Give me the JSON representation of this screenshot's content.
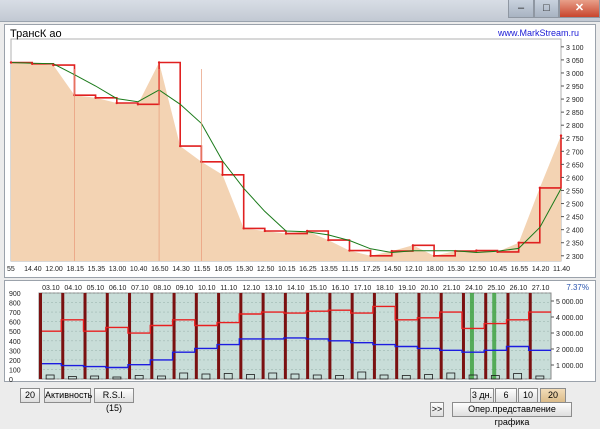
{
  "window": {
    "title": "",
    "buttons": {
      "minimize": "–",
      "maximize": "□",
      "close": "✕"
    }
  },
  "price_chart": {
    "title": "ТрансК ао",
    "site": "www.MarkStream.ru",
    "y_ticks": [
      "3 100",
      "3 050",
      "3 000",
      "2 950",
      "2 900",
      "2 850",
      "2 800",
      "2 750",
      "2 700",
      "2 650",
      "2 600",
      "2 550",
      "2 500",
      "2 450",
      "2 400",
      "2 350",
      "2 300"
    ],
    "x_ticks": [
      "55",
      "14.40",
      "12.00",
      "18.15",
      "15.35",
      "13.00",
      "10.40",
      "16.50",
      "14.30",
      "11.55",
      "18.05",
      "15.30",
      "12.50",
      "10.15",
      "16.25",
      "13.55",
      "11.15",
      "17.25",
      "14.50",
      "12.10",
      "18.00",
      "15.30",
      "12.50",
      "10.45",
      "16.55",
      "14.20",
      "11.40"
    ],
    "colors": {
      "fill": "#f3d3b3",
      "close": "#e02020",
      "ma": "#1a7a1a",
      "accent": "#2222cc"
    }
  },
  "chart_data": [
    {
      "type": "area",
      "title": "ТрансК ао",
      "ylim": [
        2280,
        3130
      ],
      "x": [
        "55",
        "14.40",
        "12.00",
        "18.15",
        "15.35",
        "13.00",
        "10.40",
        "16.50",
        "14.30",
        "11.55",
        "18.05",
        "15.30",
        "12.50",
        "10.15",
        "16.25",
        "13.55",
        "11.15",
        "17.25",
        "14.50",
        "12.10",
        "18.00",
        "15.30",
        "12.50",
        "10.45",
        "16.55",
        "14.20",
        "11.40"
      ],
      "series": [
        {
          "values": [
            3040,
            3035,
            3030,
            2915,
            2905,
            2885,
            2880,
            3040,
            2720,
            2660,
            2610,
            2405,
            2395,
            2385,
            2395,
            2360,
            2320,
            2300,
            2318,
            2340,
            2300,
            2318,
            2320,
            2315,
            2350,
            2560,
            2760
          ]
        }
      ]
    },
    {
      "type": "line",
      "categories": [
        "03.10",
        "04.10",
        "05.10",
        "06.10",
        "07.10",
        "08.10",
        "09.10",
        "10.10",
        "11.10",
        "12.10",
        "13.10",
        "14.10",
        "15.10",
        "16.10",
        "17.10",
        "18.10",
        "19.10",
        "20.10",
        "21.10",
        "24.10",
        "25.10",
        "26.10",
        "27.10"
      ],
      "ylim": [
        0,
        900
      ],
      "y2_ticks": [
        "5 000.00",
        "4 000.00",
        "3 000.00",
        "2 000.00",
        "1 000.00"
      ],
      "series": [
        {
          "color": "#e82020",
          "values": [
            500,
            620,
            500,
            540,
            480,
            560,
            620,
            560,
            590,
            680,
            700,
            690,
            710,
            720,
            690,
            760,
            620,
            640,
            700,
            530,
            580,
            620,
            700
          ]
        },
        {
          "color": "#1c1ce0",
          "values": [
            160,
            140,
            130,
            120,
            150,
            200,
            280,
            320,
            360,
            420,
            420,
            430,
            420,
            400,
            380,
            360,
            340,
            320,
            300,
            280,
            300,
            340,
            300
          ]
        }
      ],
      "volume_bars": [
        40,
        25,
        30,
        20,
        35,
        30,
        60,
        50,
        55,
        45,
        60,
        50,
        40,
        35,
        70,
        40,
        35,
        45,
        60,
        40,
        35,
        55,
        30
      ]
    }
  ],
  "indicators": {
    "y_ticks": [
      "900",
      "800",
      "700",
      "600",
      "500",
      "400",
      "300",
      "200",
      "100",
      "0"
    ],
    "pct": "7.37%"
  },
  "toolbar": {
    "period": "20",
    "activity": "Активность",
    "rsi": "R.S.I. (15)",
    "nav": ">>",
    "d3": "3 дн.",
    "d6": "6 дн.",
    "d10": "10 дн.",
    "d20": "20 дн.",
    "mode": "Опер.представление графика"
  }
}
